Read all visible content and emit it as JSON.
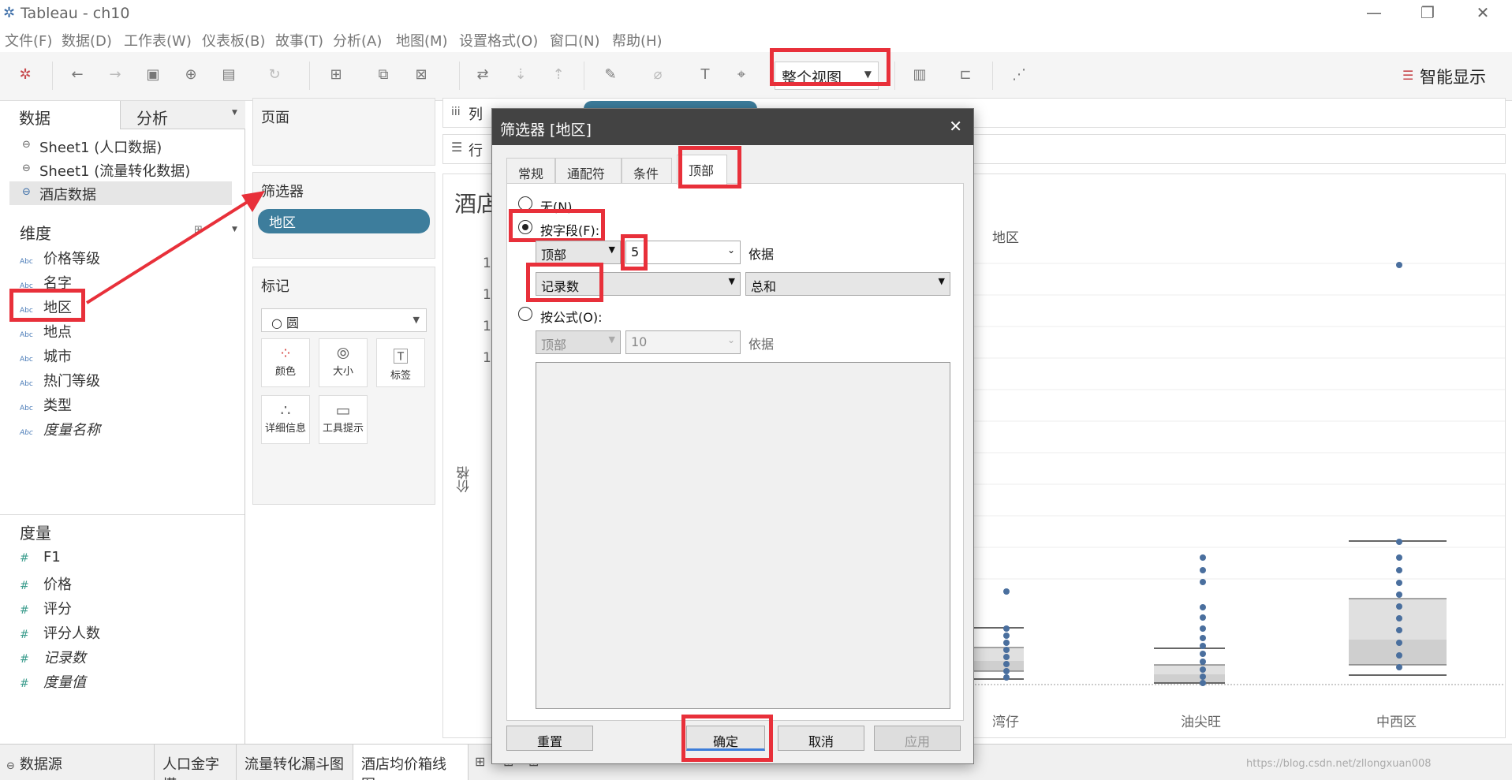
{
  "window": {
    "title": "Tableau - ch10",
    "minimize": "—",
    "restore": "❐",
    "close": "✕"
  },
  "menu": [
    "文件(F)",
    "数据(D)",
    "工作表(W)",
    "仪表板(B)",
    "故事(T)",
    "分析(A)",
    "地图(M)",
    "设置格式(O)",
    "窗口(N)",
    "帮助(H)"
  ],
  "toolbar": {
    "fit_value": "整个视图",
    "show_me": "智能显示"
  },
  "left": {
    "tab_data": "数据",
    "tab_analysis": "分析",
    "sources": [
      "Sheet1 (人口数据)",
      "Sheet1 (流量转化数据)",
      "酒店数据"
    ],
    "dimensions_label": "维度",
    "dimensions": [
      "价格等级",
      "名字",
      "地区",
      "地点",
      "城市",
      "热门等级",
      "类型",
      "度量名称"
    ],
    "measures_label": "度量",
    "measures": [
      "F1",
      "价格",
      "评分",
      "评分人数",
      "记录数",
      "度量值"
    ],
    "abc": "Abc",
    "hash": "#"
  },
  "cards": {
    "pages": "页面",
    "filters": "筛选器",
    "filter_pill": "地区",
    "marks": "标记",
    "mark_type": "○ 圆",
    "mark_buttons": [
      "颜色",
      "大小",
      "标签",
      "详细信息",
      "工具提示"
    ]
  },
  "shelves": {
    "columns": "列",
    "rows": "行"
  },
  "view": {
    "title_partial": "酒店",
    "header": "地区",
    "y_label": "价格",
    "y_ticks": [
      "1",
      "1",
      "1",
      "1"
    ],
    "categories": [
      "湾仔",
      "油尖旺",
      "中西区"
    ]
  },
  "bottom_tabs": [
    "数据源",
    "人口金字塔",
    "流量转化漏斗图",
    "酒店均价箱线图"
  ],
  "dialog": {
    "title": "筛选器 [地区]",
    "tabs": [
      "常规",
      "通配符",
      "条件",
      "顶部"
    ],
    "opt_none": "无(N)",
    "opt_field": "按字段(F):",
    "field_pos": "顶部",
    "field_n": "5",
    "by": "依据",
    "field_measure": "记录数",
    "field_agg": "总和",
    "opt_formula": "按公式(O):",
    "formula_pos": "顶部",
    "formula_n": "10",
    "btn_reset": "重置",
    "btn_ok": "确定",
    "btn_cancel": "取消",
    "btn_apply": "应用"
  },
  "watermark": "https://blog.csdn.net/zllongxuan008"
}
